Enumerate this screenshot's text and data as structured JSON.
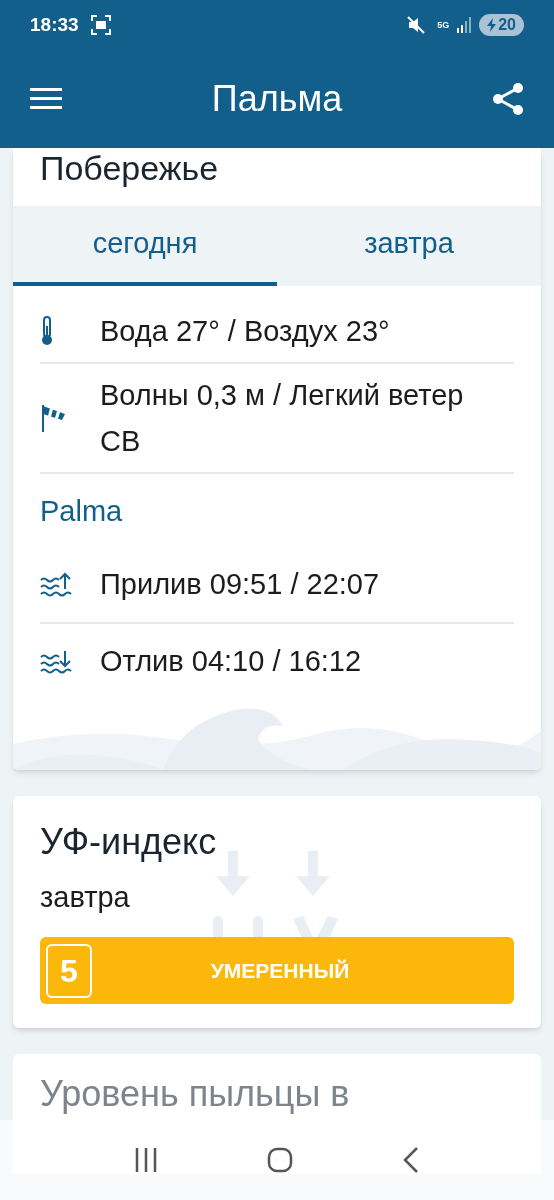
{
  "status_bar": {
    "time": "18:33",
    "battery": "20",
    "network": "5G"
  },
  "app_bar": {
    "title": "Пальма"
  },
  "coast_card": {
    "title": "Побережье",
    "tabs": [
      {
        "label": "сегодня",
        "selected": true
      },
      {
        "label": "завтра",
        "selected": false
      }
    ],
    "conditions": [
      {
        "kind": "temperature",
        "text": "Вода 27° / Воздух 23°"
      },
      {
        "kind": "wind",
        "text": "Волны 0,3 м / Легкий ветер СВ"
      }
    ],
    "tide_station": "Palma",
    "tides": [
      {
        "kind": "high",
        "text": "Прилив 09:51 / 22:07"
      },
      {
        "kind": "low",
        "text": "Отлив 04:10 / 16:12"
      }
    ]
  },
  "uv_card": {
    "title": "УФ-индекс",
    "day": "завтра",
    "value": "5",
    "label": "УМЕРЕННЫЙ",
    "color": "#fbb80a"
  },
  "pollen_card": {
    "title": "Уровень пыльцы в"
  }
}
